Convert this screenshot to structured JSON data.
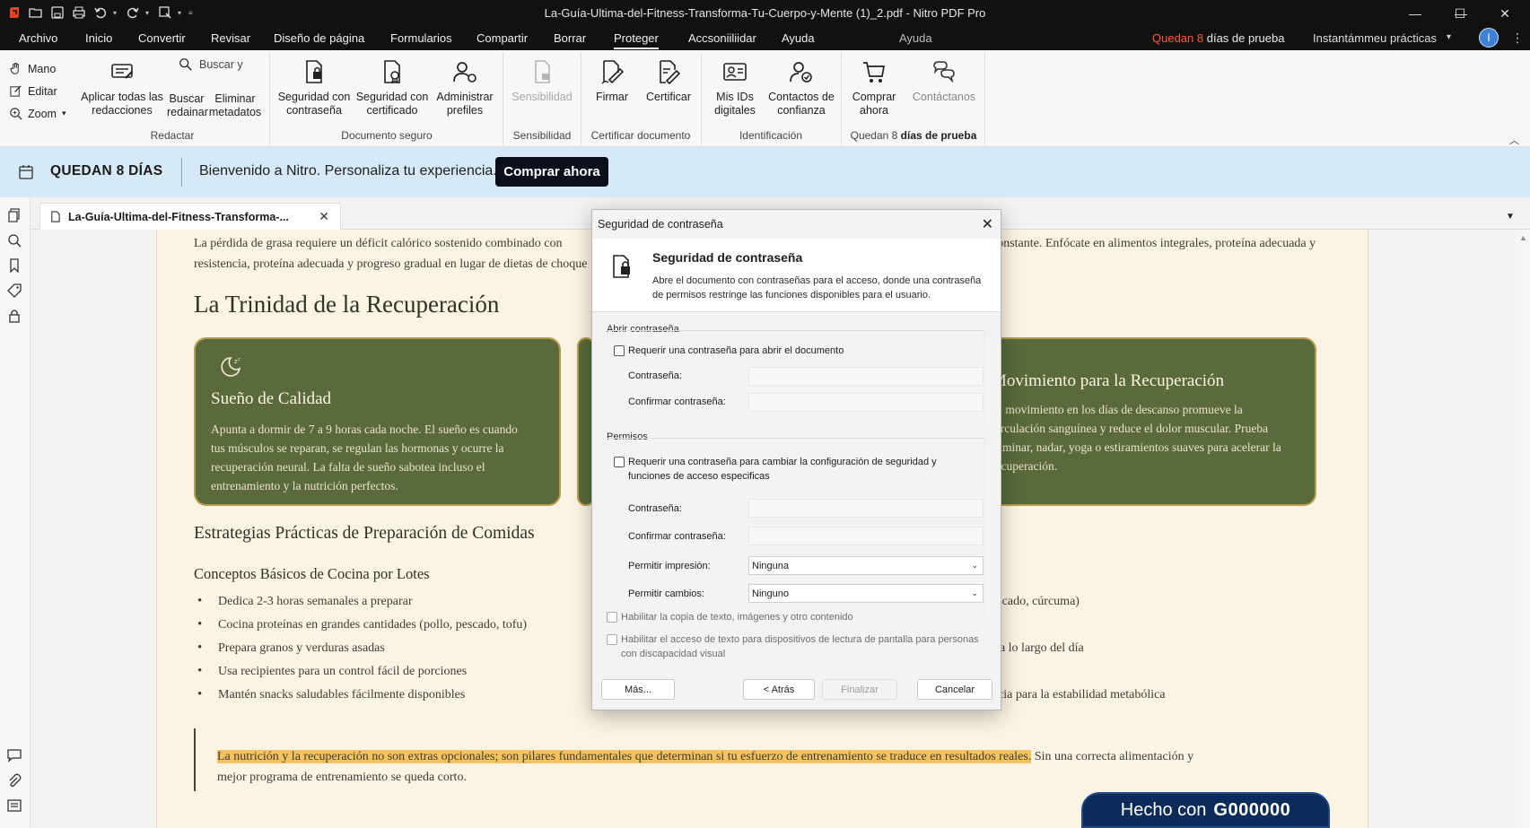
{
  "window": {
    "title": "La-Guía-Ultima-del-Fitness-Transforma-Tu-Cuerpo-y-Mente (1)_2.pdf - Nitro PDF Pro",
    "minimize": "—",
    "maximize": "☐",
    "close": "✕"
  },
  "menu": {
    "items": [
      "Archivo",
      "Inicio",
      "Convertir",
      "Revisar",
      "Diseño de página",
      "Formularios",
      "Compartir",
      "Borrar",
      "Proteger",
      "Accsoniiliidar",
      "Ayuda",
      "Ayuda"
    ],
    "active_index": 8,
    "trial_prefix": "Quedan ",
    "trial_num": "8",
    "trial_suffix": " días de prueba",
    "workspace": "Instantámmeu prácticas",
    "avatar_initial": "I",
    "accent_color": "#ff5a36"
  },
  "ribbon": {
    "left_tools": [
      "Mano",
      "Editar",
      "Zoom"
    ],
    "buttons": {
      "apply_redactions": "Aplicar todas las redacciones",
      "search_redact_top": "Buscar y",
      "search_redact_bottom": "Buscar redainar",
      "remove_metadata": "Eliminar metadatos",
      "password_security": "Seguridad con contraseña",
      "cert_security": "Seguridad con certificado",
      "manage_profiles": "Administrar prefiles",
      "sensitivity": "Sensibilidad",
      "sign": "Firmar",
      "certify": "Certificar",
      "digital_ids": "Mis IDs digitales",
      "trusted_contacts": "Contactos de confianza",
      "buy_now": "Comprar ahora",
      "contact_us": "Contáctanos"
    },
    "groups": {
      "redact": "Redactar",
      "secure_doc": "Documento seguro",
      "sensitivity": "Sensibilidad",
      "certify_doc": "Certificar documento",
      "identification": "Identificación",
      "trial_prefix": "Quedan 8 ",
      "trial_bold": "días de prueba"
    }
  },
  "banner": {
    "days_left": "QUEDAN 8 DÍAS",
    "welcome": "Bienvenido a Nitro. Personaliza tu experiencia.",
    "buy_button": "Comprar ahora"
  },
  "tab": {
    "name": "La-Guía-Ultima-del-Fitness-Transforma-...",
    "close": "✕"
  },
  "document": {
    "intro_left": "La pérdida de grasa requiere un déficit calórico sostenido combinado con resistencia, proteína adecuada y progreso gradual en lugar de dietas de choque",
    "intro_right": "constante. Enfócate en alimentos integrales, proteína adecuada y",
    "trinity_heading": "La Trinidad de la Recuperación",
    "card_sleep_title": "Sueño de Calidad",
    "card_sleep_body": "Apunta a dormir de 7 a 9 horas cada noche. El sueño es cuando tus músculos se reparan, se regulan las hormonas y ocurre la recuperación neural. La falta de sueño sabotea incluso el entrenamiento y la nutrición perfectos.",
    "card_move_title": "Movimiento para la Recuperación",
    "card_move_body": "El movimiento en los días de descanso promueve la circulación sanguínea y reduce el dolor muscular. Prueba caminar, nadar, yoga o estiramientos suaves para acelerar la recuperación.",
    "strategies_heading": "Estrategias Prácticas de Preparación de Comidas",
    "batch_heading": "Conceptos Básicos de Cocina por Lotes",
    "bullets": [
      "Dedica 2-3 horas semanales a preparar",
      "Cocina proteínas en grandes cantidades (pollo, pescado, tofu)",
      "Prepara granos y verduras asadas",
      "Usa recipientes para un control fácil de porciones",
      "Mantén snacks saludables fácilmente disponibles"
    ],
    "right_fragments": [
      "escado, cúrcuma)",
      "",
      "s a lo largo del día",
      "",
      "ncia para la estabilidad metabólica"
    ],
    "quote_highlight": "La nutrición y la recuperación no son extras opcionales; son pilares fundamentales que determinan si tu esfuerzo de entrenamiento se traduce en resultados reales.",
    "quote_rest": " Sin una correcta alimentación y mejor programa de entrenamiento se queda corto.",
    "made_with_prefix": "Hecho con",
    "made_with_brand": "G000000",
    "highlight_color": "#f4c25e",
    "card_color": "#5a6a3a"
  },
  "dialog": {
    "window_title": "Seguridad de contraseña",
    "header_title": "Seguridad de contraseña",
    "header_desc": "Abre el documento con contraseñas para el acceso, donde una contraseña de permisos restringe las funciones disponibles para el usuario.",
    "open_section": "Abrir contraseña",
    "open_checkbox": "Requerir una contraseña para abrir el documento",
    "password_label": "Contraseña:",
    "confirm_label": "Confirmar contraseña:",
    "perm_section": "Permisos",
    "perm_checkbox": "Requerir una contraseña para cambiar la configuración de seguridad y funciones de acceso especificas",
    "perm_password_label": "Contraseña:",
    "perm_confirm_label": "Confirmar contraseña:",
    "print_label": "Permitir impresión:",
    "print_value": "Ninguna",
    "changes_label": "Permitir cambios:",
    "changes_value": "Ninguno",
    "copy_checkbox": "Habilitar la copia de texto, imágenes y otro contenido",
    "access_checkbox": "Habilitar el acceso de texto para dispositivos de lectura de pantalla para personas con discapacidad visual",
    "more_button": "Más...",
    "back_button": "< Atrás",
    "finish_button": "Finalizar",
    "cancel_button": "Cancelar"
  }
}
